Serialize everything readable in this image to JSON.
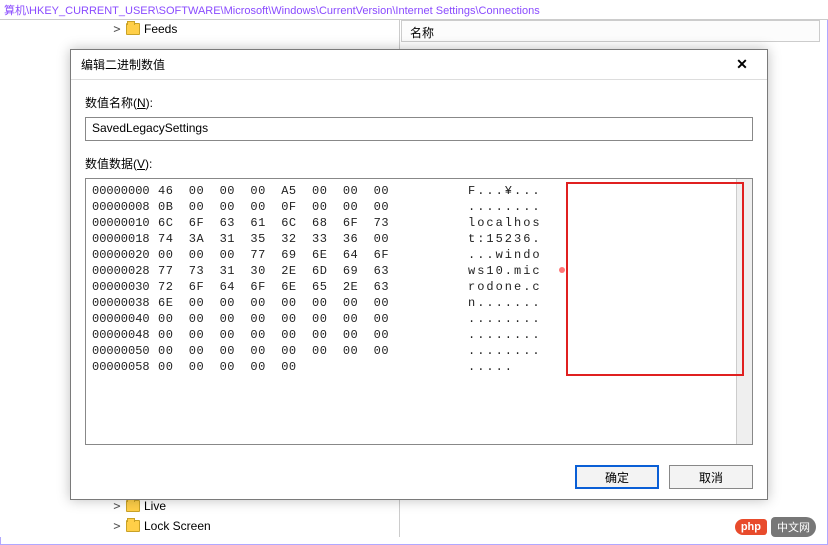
{
  "pathbar": "算机\\HKEY_CURRENT_USER\\SOFTWARE\\Microsoft\\Windows\\CurrentVersion\\Internet Settings\\Connections",
  "tree": {
    "items_top": [
      {
        "expand": ">",
        "label": "Feeds"
      }
    ],
    "items_bottom": [
      {
        "expand": ">",
        "label": "Live"
      },
      {
        "expand": ">",
        "label": "Lock Screen"
      }
    ]
  },
  "list": {
    "header_name": "名称"
  },
  "dialog": {
    "title": "编辑二进制数值",
    "name_label_pre": "数值名称(",
    "name_label_u": "N",
    "name_label_post": "):",
    "name_value": "SavedLegacySettings",
    "data_label_pre": "数值数据(",
    "data_label_u": "V",
    "data_label_post": "):",
    "ok_label": "确定",
    "cancel_label": "取消"
  },
  "hex": {
    "rows": [
      {
        "offset": "00000000",
        "bytes": "46  00  00  00  A5  00  00  00",
        "ascii": "F...¥..."
      },
      {
        "offset": "00000008",
        "bytes": "0B  00  00  00  0F  00  00  00",
        "ascii": "........"
      },
      {
        "offset": "00000010",
        "bytes": "6C  6F  63  61  6C  68  6F  73",
        "ascii": "localhos"
      },
      {
        "offset": "00000018",
        "bytes": "74  3A  31  35  32  33  36  00",
        "ascii": "t:15236."
      },
      {
        "offset": "00000020",
        "bytes": "00  00  00  77  69  6E  64  6F",
        "ascii": "...windo"
      },
      {
        "offset": "00000028",
        "bytes": "77  73  31  30  2E  6D  69  63",
        "ascii": "ws10.mic"
      },
      {
        "offset": "00000030",
        "bytes": "72  6F  64  6F  6E  65  2E  63",
        "ascii": "rodone.c"
      },
      {
        "offset": "00000038",
        "bytes": "6E  00  00  00  00  00  00  00",
        "ascii": "n......."
      },
      {
        "offset": "00000040",
        "bytes": "00  00  00  00  00  00  00  00",
        "ascii": "........"
      },
      {
        "offset": "00000048",
        "bytes": "00  00  00  00  00  00  00  00",
        "ascii": "........"
      },
      {
        "offset": "00000050",
        "bytes": "00  00  00  00  00  00  00  00",
        "ascii": "........"
      },
      {
        "offset": "00000058",
        "bytes": "00  00  00  00  00",
        "ascii": "....."
      }
    ]
  },
  "logo": {
    "badge": "php",
    "text": "中文网"
  }
}
